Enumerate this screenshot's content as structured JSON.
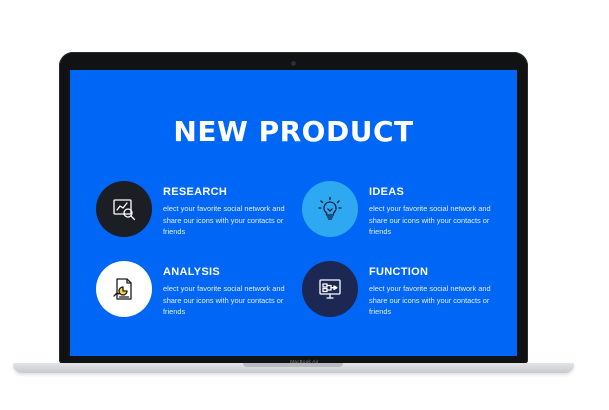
{
  "slide": {
    "title": "NEW PRODUCT"
  },
  "features": [
    {
      "heading": "RESEARCH",
      "description": "elect your favorite social network and share our icons with your contacts or friends",
      "icon": "research-analytics-icon",
      "circle_color": "#1c1e26"
    },
    {
      "heading": "IDEAS",
      "description": "elect your favorite social network and share our icons with your contacts or friends",
      "icon": "lightbulb-icon",
      "circle_color": "#2ea8f0"
    },
    {
      "heading": "ANALYSIS",
      "description": "elect your favorite social network and share our icons with your contacts or friends",
      "icon": "chart-document-icon",
      "circle_color": "#ffffff"
    },
    {
      "heading": "FUNCTION",
      "description": "elect your favorite social network and share our icons with your contacts or friends",
      "icon": "monitor-flowchart-icon",
      "circle_color": "#1c2754"
    }
  ],
  "device": {
    "label": "MacBook Air"
  },
  "colors": {
    "screen_background": "#0066f5",
    "text": "#ffffff"
  }
}
